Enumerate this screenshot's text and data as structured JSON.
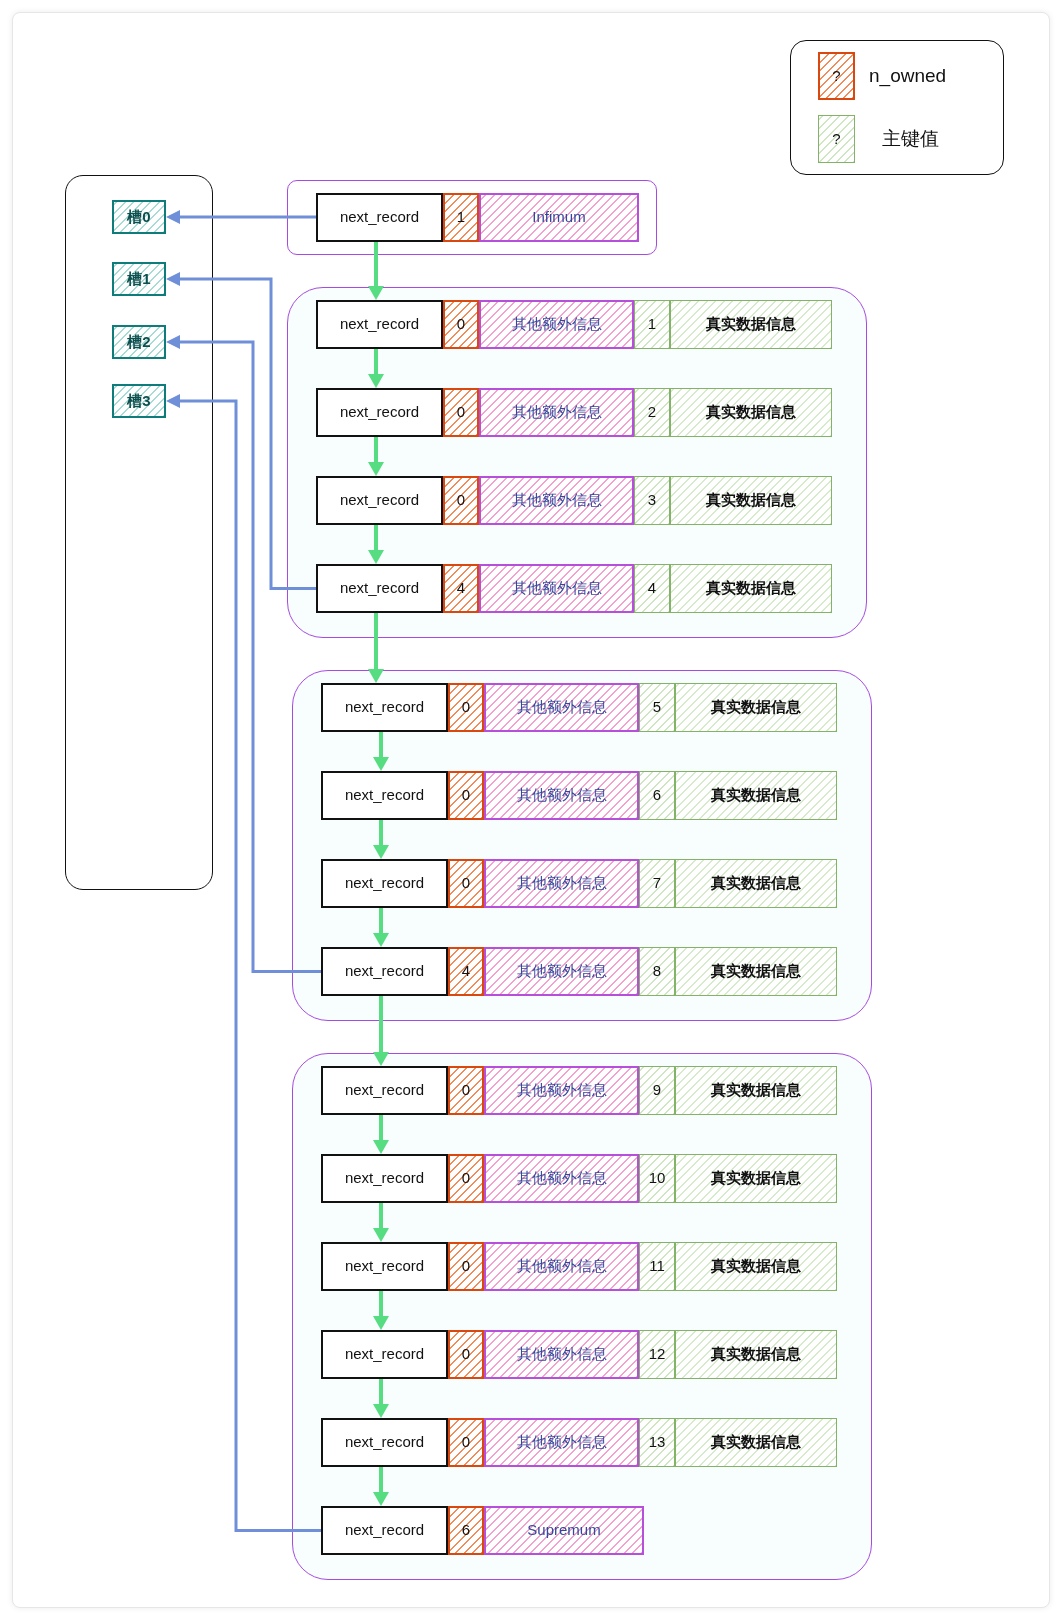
{
  "legend": [
    {
      "kind": "n_owned",
      "swatch": "?",
      "label": "n_owned"
    },
    {
      "kind": "key",
      "swatch": "?",
      "label": "主键值"
    }
  ],
  "slots": [
    {
      "label": "槽0"
    },
    {
      "label": "槽1"
    },
    {
      "label": "槽2"
    },
    {
      "label": "槽3"
    }
  ],
  "groups": [
    {
      "records": [
        {
          "kind": "infimum",
          "next": "next_record",
          "n_owned": "1",
          "info": "Infimum"
        }
      ]
    },
    {
      "records": [
        {
          "kind": "user",
          "next": "next_record",
          "n_owned": "0",
          "info": "其他额外信息",
          "key": "1",
          "data": "真实数据信息"
        },
        {
          "kind": "user",
          "next": "next_record",
          "n_owned": "0",
          "info": "其他额外信息",
          "key": "2",
          "data": "真实数据信息"
        },
        {
          "kind": "user",
          "next": "next_record",
          "n_owned": "0",
          "info": "其他额外信息",
          "key": "3",
          "data": "真实数据信息"
        },
        {
          "kind": "user",
          "next": "next_record",
          "n_owned": "4",
          "info": "其他额外信息",
          "key": "4",
          "data": "真实数据信息"
        }
      ]
    },
    {
      "records": [
        {
          "kind": "user",
          "next": "next_record",
          "n_owned": "0",
          "info": "其他额外信息",
          "key": "5",
          "data": "真实数据信息"
        },
        {
          "kind": "user",
          "next": "next_record",
          "n_owned": "0",
          "info": "其他额外信息",
          "key": "6",
          "data": "真实数据信息"
        },
        {
          "kind": "user",
          "next": "next_record",
          "n_owned": "0",
          "info": "其他额外信息",
          "key": "7",
          "data": "真实数据信息"
        },
        {
          "kind": "user",
          "next": "next_record",
          "n_owned": "4",
          "info": "其他额外信息",
          "key": "8",
          "data": "真实数据信息"
        }
      ]
    },
    {
      "records": [
        {
          "kind": "user",
          "next": "next_record",
          "n_owned": "0",
          "info": "其他额外信息",
          "key": "9",
          "data": "真实数据信息"
        },
        {
          "kind": "user",
          "next": "next_record",
          "n_owned": "0",
          "info": "其他额外信息",
          "key": "10",
          "data": "真实数据信息"
        },
        {
          "kind": "user",
          "next": "next_record",
          "n_owned": "0",
          "info": "其他额外信息",
          "key": "11",
          "data": "真实数据信息"
        },
        {
          "kind": "user",
          "next": "next_record",
          "n_owned": "0",
          "info": "其他额外信息",
          "key": "12",
          "data": "真实数据信息"
        },
        {
          "kind": "user",
          "next": "next_record",
          "n_owned": "0",
          "info": "其他额外信息",
          "key": "13",
          "data": "真实数据信息"
        },
        {
          "kind": "supremum",
          "next": "next_record",
          "n_owned": "6",
          "info": "Supremum"
        }
      ]
    }
  ]
}
